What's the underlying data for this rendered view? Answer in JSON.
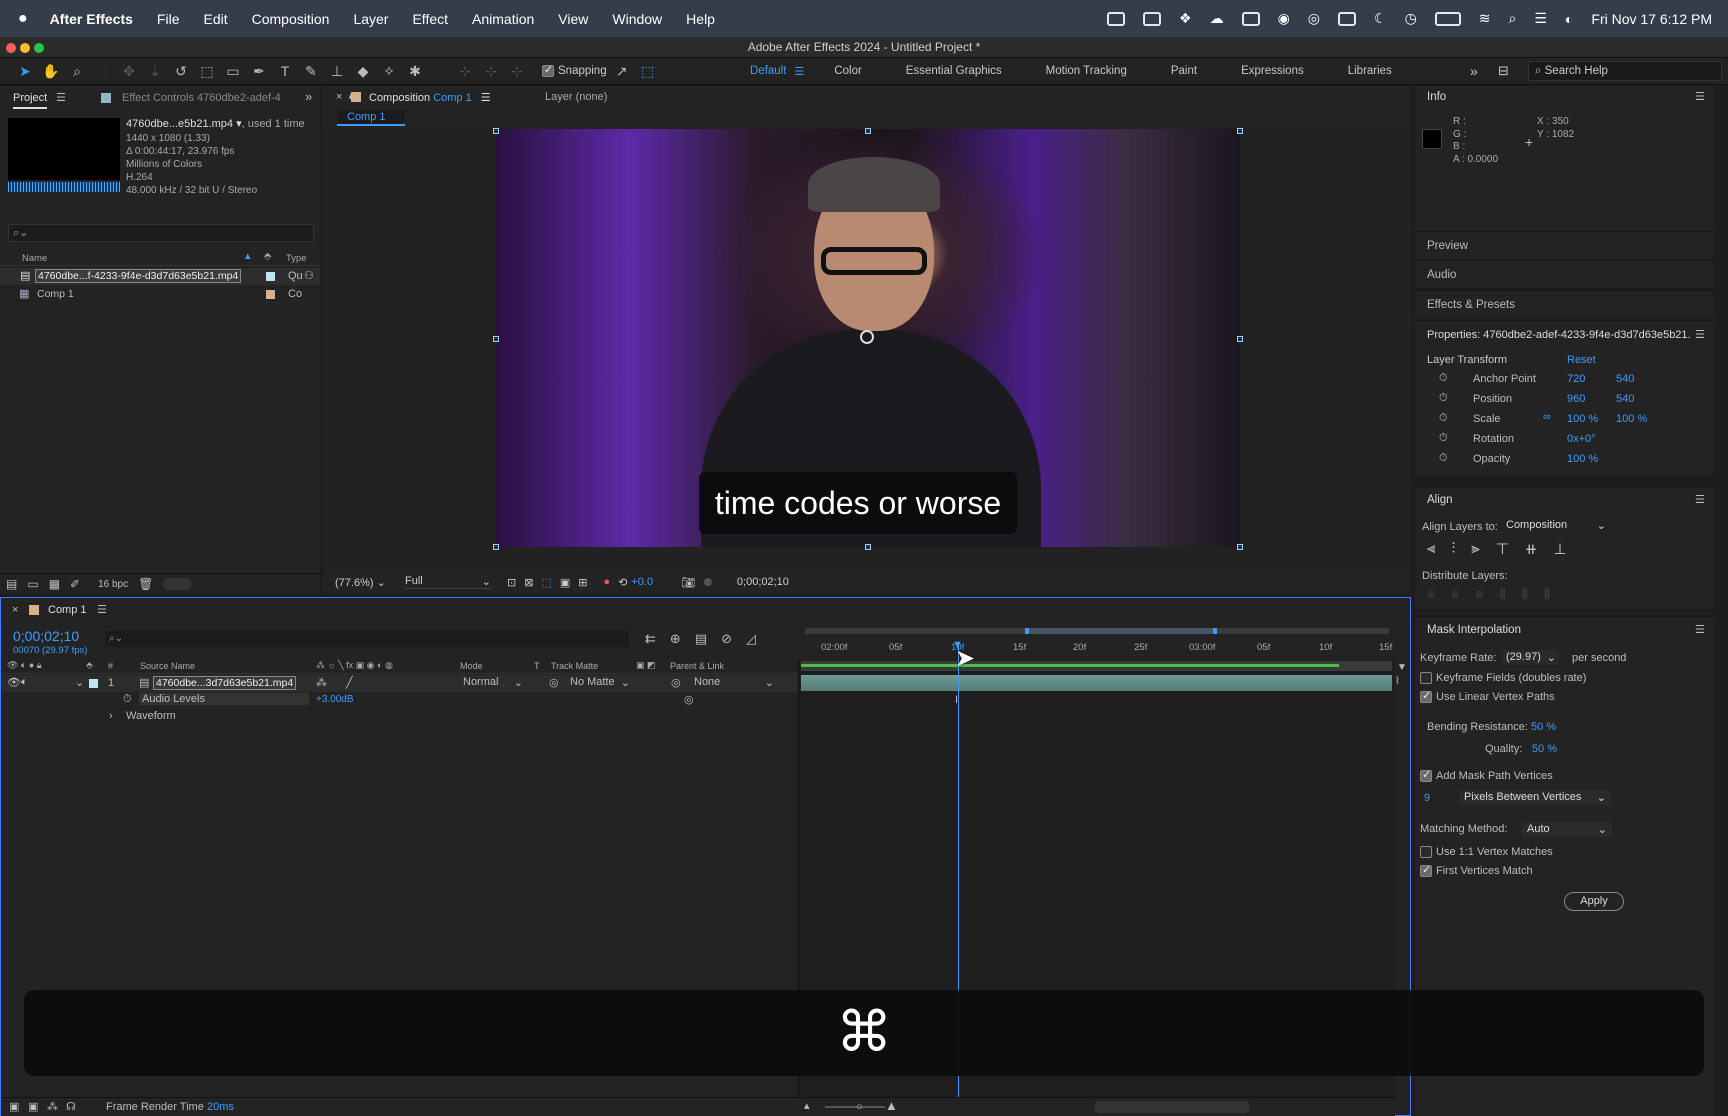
{
  "menubar": {
    "app": "After Effects",
    "items": [
      "File",
      "Edit",
      "Composition",
      "Layer",
      "Effect",
      "Animation",
      "View",
      "Window",
      "Help"
    ],
    "clock": "Fri Nov 17  6:12 PM"
  },
  "window": {
    "title": "Adobe After Effects 2024 - Untitled Project *"
  },
  "toolbar": {
    "snapping": "Snapping",
    "workspaces": [
      "Default",
      "Color",
      "Essential Graphics",
      "Motion Tracking",
      "Paint",
      "Expressions",
      "Libraries"
    ],
    "search_placeholder": "Search Help"
  },
  "project": {
    "tab": "Project",
    "tab2": "Effect Controls 4760dbe2-adef-4",
    "file_name": "4760dbe...e5b21.mp4",
    "used": ", used 1 time",
    "info": [
      "1440 x 1080 (1.33)",
      "Δ 0:00:44:17, 23.976 fps",
      "Millions of Colors",
      "H.264",
      "48.000 kHz / 32 bit U / Stereo"
    ],
    "col_name": "Name",
    "col_type": "Type",
    "items": [
      {
        "name": "4760dbe...f-4233-9f4e-d3d7d63e5b21.mp4",
        "type": "Qu"
      },
      {
        "name": "Comp 1",
        "type": "Co"
      }
    ],
    "bpc": "16 bpc"
  },
  "composition": {
    "tab_prefix": "Composition",
    "tab_name": "Comp 1",
    "layer_tab": "Layer (none)",
    "breadcrumb": "Comp 1",
    "caption": "time codes or worse",
    "zoom": "(77.6%)",
    "quality": "Full",
    "exposure": "+0.0",
    "timecode": "0;00;02;10"
  },
  "info": {
    "title": "Info",
    "r": "R :",
    "g": "G :",
    "b": "B :",
    "a": "A :  0.0000",
    "x": "X :  350",
    "y": "Y :  1082"
  },
  "sections": [
    "Preview",
    "Audio",
    "Effects & Presets"
  ],
  "properties": {
    "title": "Properties: 4760dbe2-adef-4233-9f4e-d3d7d63e5b21.",
    "group": "Layer Transform",
    "reset": "Reset",
    "rows": [
      {
        "label": "Anchor Point",
        "v1": "720",
        "v2": "540"
      },
      {
        "label": "Position",
        "v1": "960",
        "v2": "540"
      },
      {
        "label": "Scale",
        "v1": "100 %",
        "v2": "100 %"
      },
      {
        "label": "Rotation",
        "v1": "0x+0°",
        "v2": ""
      },
      {
        "label": "Opacity",
        "v1": "100 %",
        "v2": ""
      }
    ]
  },
  "align": {
    "title": "Align",
    "align_to_label": "Align Layers to:",
    "align_to": "Composition",
    "distribute": "Distribute Layers:"
  },
  "mask": {
    "title": "Mask Interpolation",
    "keyframe_rate_label": "Keyframe Rate:",
    "keyframe_rate": "(29.97)",
    "per_second": "per second",
    "keyframe_fields": "Keyframe Fields (doubles rate)",
    "linear_paths": "Use Linear Vertex Paths",
    "bending_label": "Bending Resistance:",
    "bending": "50 %",
    "quality_label": "Quality:",
    "quality": "50 %",
    "add_vertices": "Add Mask Path Vertices",
    "vertices_num": "9",
    "vertices_mode": "Pixels Between Vertices",
    "matching_label": "Matching Method:",
    "matching": "Auto",
    "one_to_one": "Use 1:1 Vertex Matches",
    "first_match": "First Vertices Match",
    "apply": "Apply"
  },
  "timeline": {
    "tab": "Comp 1",
    "timecode": "0;00;02;10",
    "frames": "00070 (29.97 fps)",
    "col_source": "Source Name",
    "col_mode": "Mode",
    "col_t": "T",
    "col_matte": "Track Matte",
    "col_parent": "Parent & Link",
    "layer_num": "1",
    "layer_name": "4760dbe...3d7d63e5b21.mp4",
    "mode": "Normal",
    "matte": "No Matte",
    "parent": "None",
    "audio_levels": "Audio Levels",
    "audio_value": "+3.00dB",
    "waveform": "Waveform",
    "ruler": [
      "02:00f",
      "05f",
      "10f",
      "15f",
      "20f",
      "25f",
      "03:00f",
      "05f",
      "10f",
      "15f"
    ],
    "frame_render_label": "Frame Render Time",
    "frame_render_value": "20ms"
  },
  "overlay": {
    "key": "⌘"
  }
}
